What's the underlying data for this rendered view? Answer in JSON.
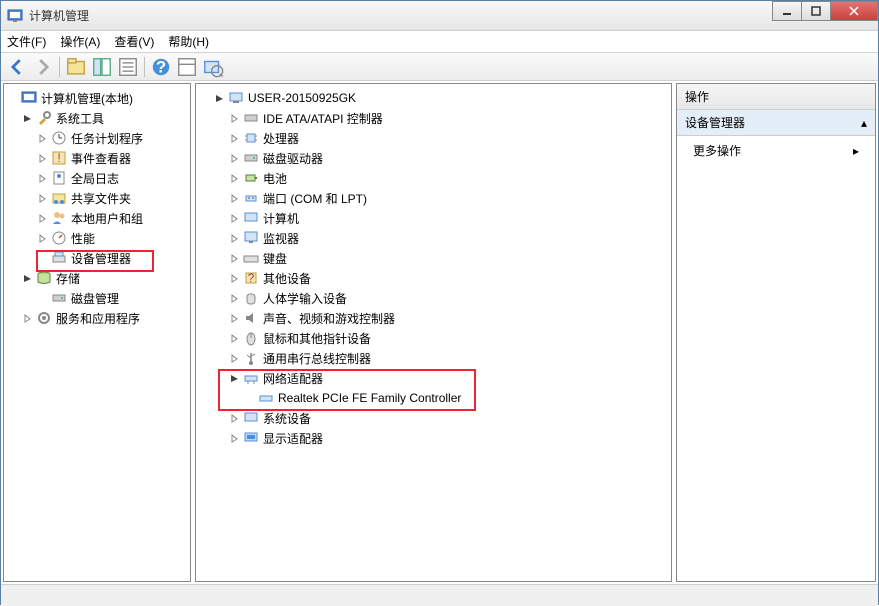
{
  "window": {
    "title": "计算机管理"
  },
  "menu": {
    "file": "文件(F)",
    "action": "操作(A)",
    "view": "查看(V)",
    "help": "帮助(H)"
  },
  "left_tree": {
    "root": "计算机管理(本地)",
    "system_tools": "系统工具",
    "task_scheduler": "任务计划程序",
    "event_viewer": "事件查看器",
    "global_log": "全局日志",
    "shared_folders": "共享文件夹",
    "local_users": "本地用户和组",
    "performance": "性能",
    "device_manager": "设备管理器",
    "storage": "存储",
    "disk_mgmt": "磁盘管理",
    "services_apps": "服务和应用程序"
  },
  "mid_tree": {
    "root": "USER-20150925GK",
    "ide": "IDE ATA/ATAPI 控制器",
    "cpu": "处理器",
    "disk_drives": "磁盘驱动器",
    "battery": "电池",
    "ports": "端口 (COM 和 LPT)",
    "computer": "计算机",
    "monitor": "监视器",
    "keyboard": "键盘",
    "other": "其他设备",
    "hid": "人体学输入设备",
    "sound": "声音、视频和游戏控制器",
    "mouse": "鼠标和其他指针设备",
    "usb": "通用串行总线控制器",
    "network": "网络适配器",
    "nic_device": "Realtek PCIe FE Family Controller",
    "system_devices": "系统设备",
    "display": "显示适配器"
  },
  "actions": {
    "header": "操作",
    "sub": "设备管理器",
    "more": "更多操作"
  }
}
